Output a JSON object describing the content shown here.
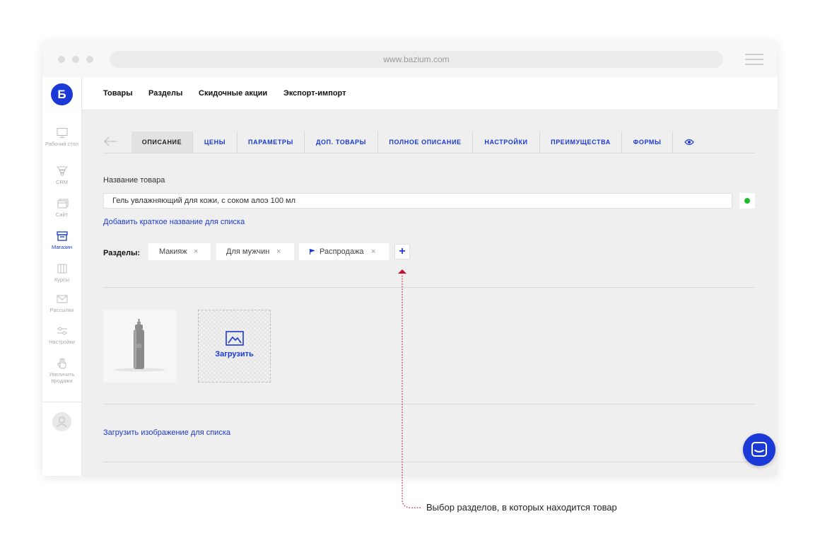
{
  "browser": {
    "url": "www.bazium.com"
  },
  "logo": {
    "letter": "Б"
  },
  "sidebar": {
    "items": [
      {
        "label": "Рабочий стол",
        "icon": "monitor-icon",
        "active": false
      },
      {
        "label": "CRM",
        "icon": "funnel-icon",
        "active": false
      },
      {
        "label": "Сайт",
        "icon": "site-icon",
        "active": false
      },
      {
        "label": "Магазин",
        "icon": "shop-icon",
        "active": true
      },
      {
        "label": "Курсы",
        "icon": "courses-icon",
        "active": false
      },
      {
        "label": "Рассылки",
        "icon": "mail-icon",
        "active": false
      },
      {
        "label": "Настройки",
        "icon": "sliders-icon",
        "active": false
      },
      {
        "label": "Увеличить продажи",
        "icon": "hand-icon",
        "active": false
      }
    ]
  },
  "topnav": {
    "items": [
      "Товары",
      "Разделы",
      "Скидочные акции",
      "Экспорт-импорт"
    ]
  },
  "tabs": {
    "items": [
      {
        "label": "ОПИСАНИЕ",
        "active": true
      },
      {
        "label": "ЦЕНЫ",
        "active": false
      },
      {
        "label": "ПАРАМЕТРЫ",
        "active": false
      },
      {
        "label": "ДОП. ТОВАРЫ",
        "active": false
      },
      {
        "label": "ПОЛНОЕ ОПИСАНИЕ",
        "active": false
      },
      {
        "label": "НАСТРОЙКИ",
        "active": false
      },
      {
        "label": "ПРЕИМУЩЕСТВА",
        "active": false
      },
      {
        "label": "ФОРМЫ",
        "active": false
      }
    ]
  },
  "product": {
    "name_label": "Название товара",
    "name_value": "Гель увлажняющий для кожи, с соком алоэ 100 мл",
    "add_short_name": "Добавить краткое название для списка"
  },
  "sections": {
    "label": "Разделы:",
    "chips": [
      {
        "label": "Макияж",
        "flag": false
      },
      {
        "label": "Для мужчин",
        "flag": false
      },
      {
        "label": "Распродажа",
        "flag": true
      }
    ],
    "add_symbol": "+",
    "remove_symbol": "×"
  },
  "upload": {
    "label": "Загрузить"
  },
  "upload_list_image": "Загрузить изображение для списка",
  "annotation": "Выбор разделов, в которых находится товар",
  "colors": {
    "accent": "#1a39d6",
    "status": "#1fbf2c",
    "annotation_line": "#c8102e"
  }
}
